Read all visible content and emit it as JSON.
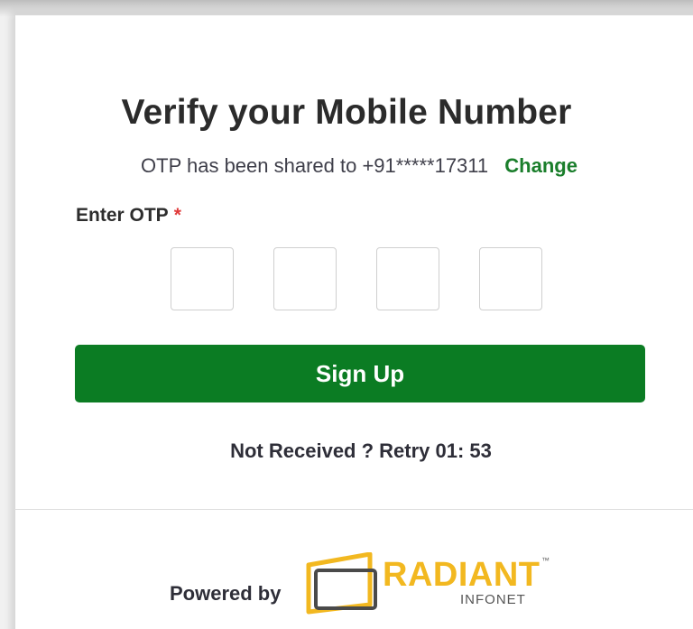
{
  "form": {
    "title": "Verify your Mobile Number",
    "subtitle": "OTP has been shared to +91*****17311",
    "change_link": "Change",
    "otp_label": "Enter OTP",
    "required_mark": "*",
    "otp_digits": [
      "",
      "",
      "",
      ""
    ],
    "signup_label": "Sign Up",
    "retry_text": "Not Received ? Retry 01: 53"
  },
  "footer": {
    "powered_by": "Powered by",
    "logo_name": "RADIANT",
    "logo_subtitle": "INFONET",
    "logo_tm": "™"
  },
  "colors": {
    "accent_green": "#0b7c23",
    "link_green": "#1a7e2b",
    "required_red": "#e03a3a",
    "logo_yellow": "#f2b820"
  }
}
